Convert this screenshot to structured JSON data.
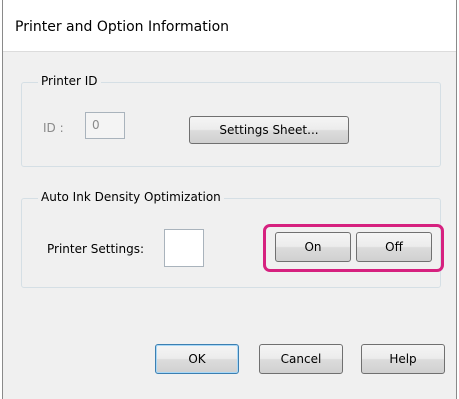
{
  "window": {
    "title": "Printer and Option Information"
  },
  "printer_id_group": {
    "legend": "Printer ID",
    "id_label": "ID :",
    "id_value": "0",
    "settings_sheet_label": "Settings Sheet..."
  },
  "auto_ink_group": {
    "legend": "Auto Ink Density Optimization",
    "printer_settings_label": "Printer Settings:",
    "printer_settings_value": "",
    "on_label": "On",
    "off_label": "Off",
    "highlight_color": "#d6217f"
  },
  "footer": {
    "ok_label": "OK",
    "cancel_label": "Cancel",
    "help_label": "Help"
  }
}
